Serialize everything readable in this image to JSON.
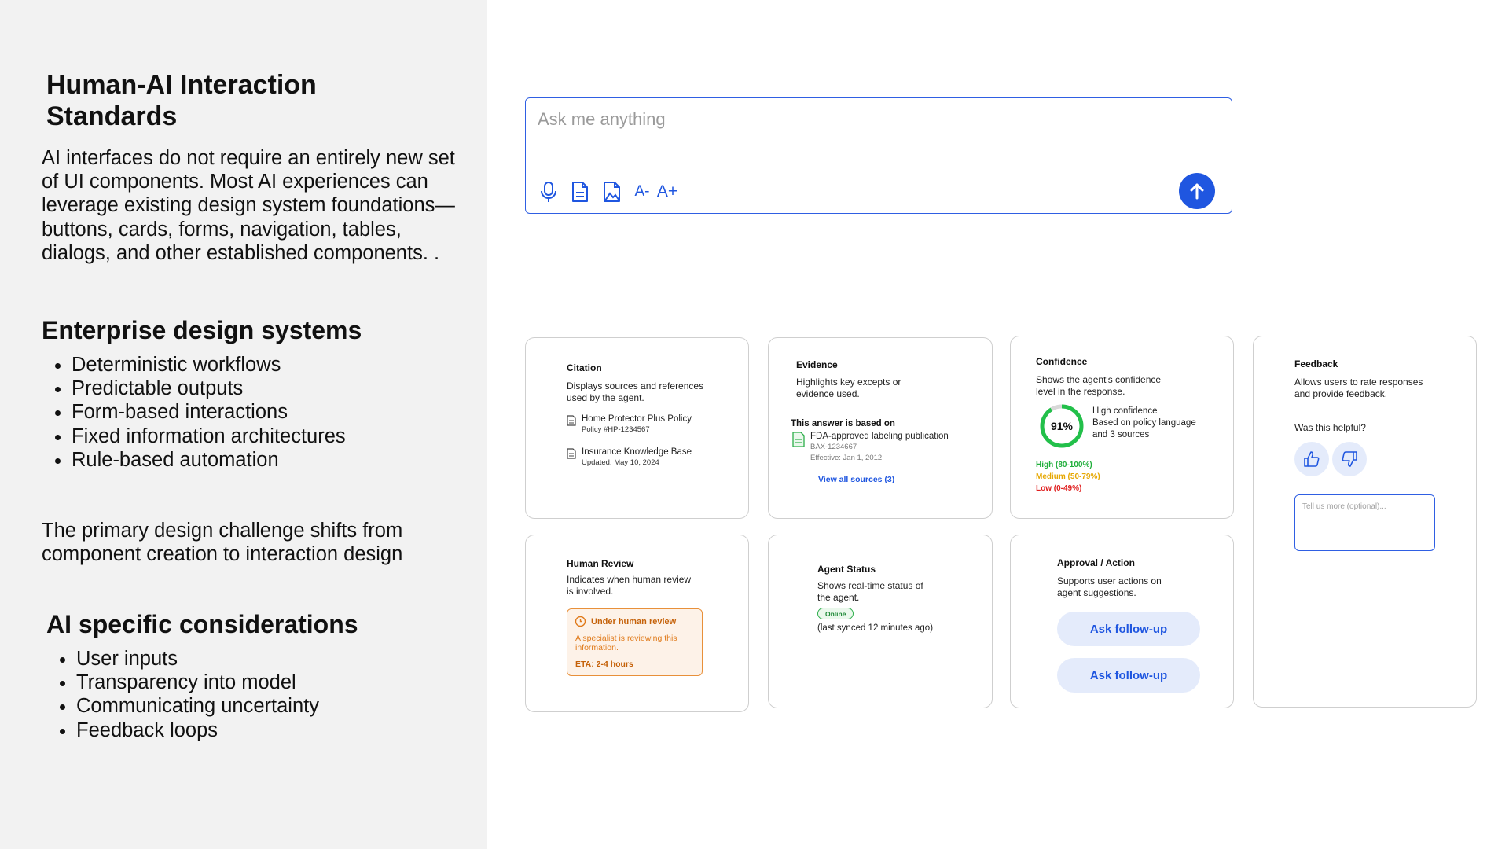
{
  "left": {
    "title": "Human-AI Interaction Standards",
    "intro": "AI interfaces do not require an entirely new set of UI components. Most AI experiences can leverage existing design system foundations—buttons, cards, forms, navigation, tables, dialogs, and other established components. .",
    "enterprise_heading": "Enterprise design systems",
    "enterprise_items": [
      "Deterministic workflows",
      "Predictable outputs",
      "Form-based interactions",
      "Fixed information architectures",
      "Rule-based automation"
    ],
    "shift_text": "The primary design challenge shifts from component creation to interaction design",
    "ai_heading": "AI specific considerations",
    "ai_items": [
      "User inputs",
      "Transparency into model",
      "Communicating uncertainty",
      "Feedback loops"
    ]
  },
  "ask": {
    "placeholder": "Ask me anything",
    "decrease_label": "A-",
    "increase_label": "A+"
  },
  "citation": {
    "title": "Citation",
    "desc": "Displays sources and references used by the agent.",
    "sources": [
      {
        "name": "Home Protector Plus Policy",
        "meta": "Policy #HP-1234567"
      },
      {
        "name": "Insurance Knowledge Base",
        "meta": "Updated: May 10, 2024"
      }
    ]
  },
  "evidence": {
    "title": "Evidence",
    "desc": "Highlights key excepts or evidence used.",
    "based_on": "This answer is based on",
    "source_name": "FDA-approved labeling publication",
    "source_id": "BAX-1234667",
    "source_date": "Effective: Jan 1, 2012",
    "view_all": "View all sources (3)"
  },
  "confidence": {
    "title": "Confidence",
    "desc": "Shows the agent's confidence level in the response.",
    "value": 91,
    "value_label": "91%",
    "level": "High confidence",
    "basis": "Based on policy language and 3 sources",
    "legend": [
      {
        "label": "High (80-100%)",
        "color": "#1fae3a"
      },
      {
        "label": "Medium (50-79%)",
        "color": "#e6a700"
      },
      {
        "label": "Low (0-49%)",
        "color": "#e02020"
      }
    ],
    "ring_color": "#22c04a"
  },
  "feedback": {
    "title": "Feedback",
    "desc": "Allows users to rate responses and provide feedback.",
    "question": "Was this helpful?",
    "placeholder": "Tell us more (optional)..."
  },
  "human_review": {
    "title": "Human Review",
    "desc": "Indicates when human review is involved.",
    "status": "Under human review",
    "message": "A specialist is reviewing this information.",
    "eta": "ETA: 2-4 hours"
  },
  "agent_status": {
    "title": "Agent Status",
    "desc": "Shows real-time status of the agent.",
    "badge": "Online",
    "synced": "(last synced 12 minutes ago)"
  },
  "approval": {
    "title": "Approval / Action",
    "desc": "Supports user actions on agent suggestions.",
    "buttons": [
      "Ask follow-up",
      "Ask follow-up"
    ]
  },
  "colors": {
    "accent": "#1f56e0",
    "panel": "#f2f2f2",
    "review_orange": "#e07a1a"
  }
}
